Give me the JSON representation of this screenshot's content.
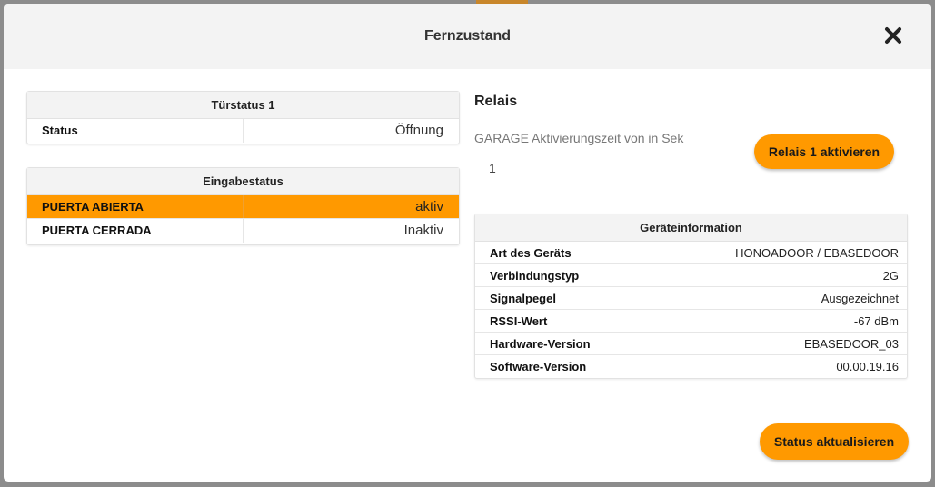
{
  "modal": {
    "title": "Fernzustand",
    "close_icon": "close-icon"
  },
  "door_status": {
    "header": "Türstatus 1",
    "rows": [
      {
        "label": "Status",
        "value": "Öffnung"
      }
    ]
  },
  "input_status": {
    "header": "Eingabestatus",
    "rows": [
      {
        "label": "PUERTA ABIERTA",
        "value": "aktiv",
        "active": true
      },
      {
        "label": "PUERTA CERRADA",
        "value": "Inaktiv",
        "active": false
      }
    ]
  },
  "relay": {
    "title": "Relais",
    "field_label": "GARAGE Aktivierungszeit von in Sek",
    "field_value": "1",
    "activate_button": "Relais 1 aktivieren"
  },
  "device_info": {
    "header": "Geräteinformation",
    "rows": [
      {
        "label": "Art des Geräts",
        "value": "HONOADOOR / EBASEDOOR"
      },
      {
        "label": "Verbindungstyp",
        "value": "2G"
      },
      {
        "label": "Signalpegel",
        "value": "Ausgezeichnet"
      },
      {
        "label": "RSSI-Wert",
        "value": "-67 dBm"
      },
      {
        "label": "Hardware-Version",
        "value": "EBASEDOOR_03"
      },
      {
        "label": "Software-Version",
        "value": "00.00.19.16"
      }
    ]
  },
  "footer": {
    "refresh_button": "Status aktualisieren"
  },
  "colors": {
    "accent": "#ff9900",
    "header_bg": "#f3f3f3"
  }
}
